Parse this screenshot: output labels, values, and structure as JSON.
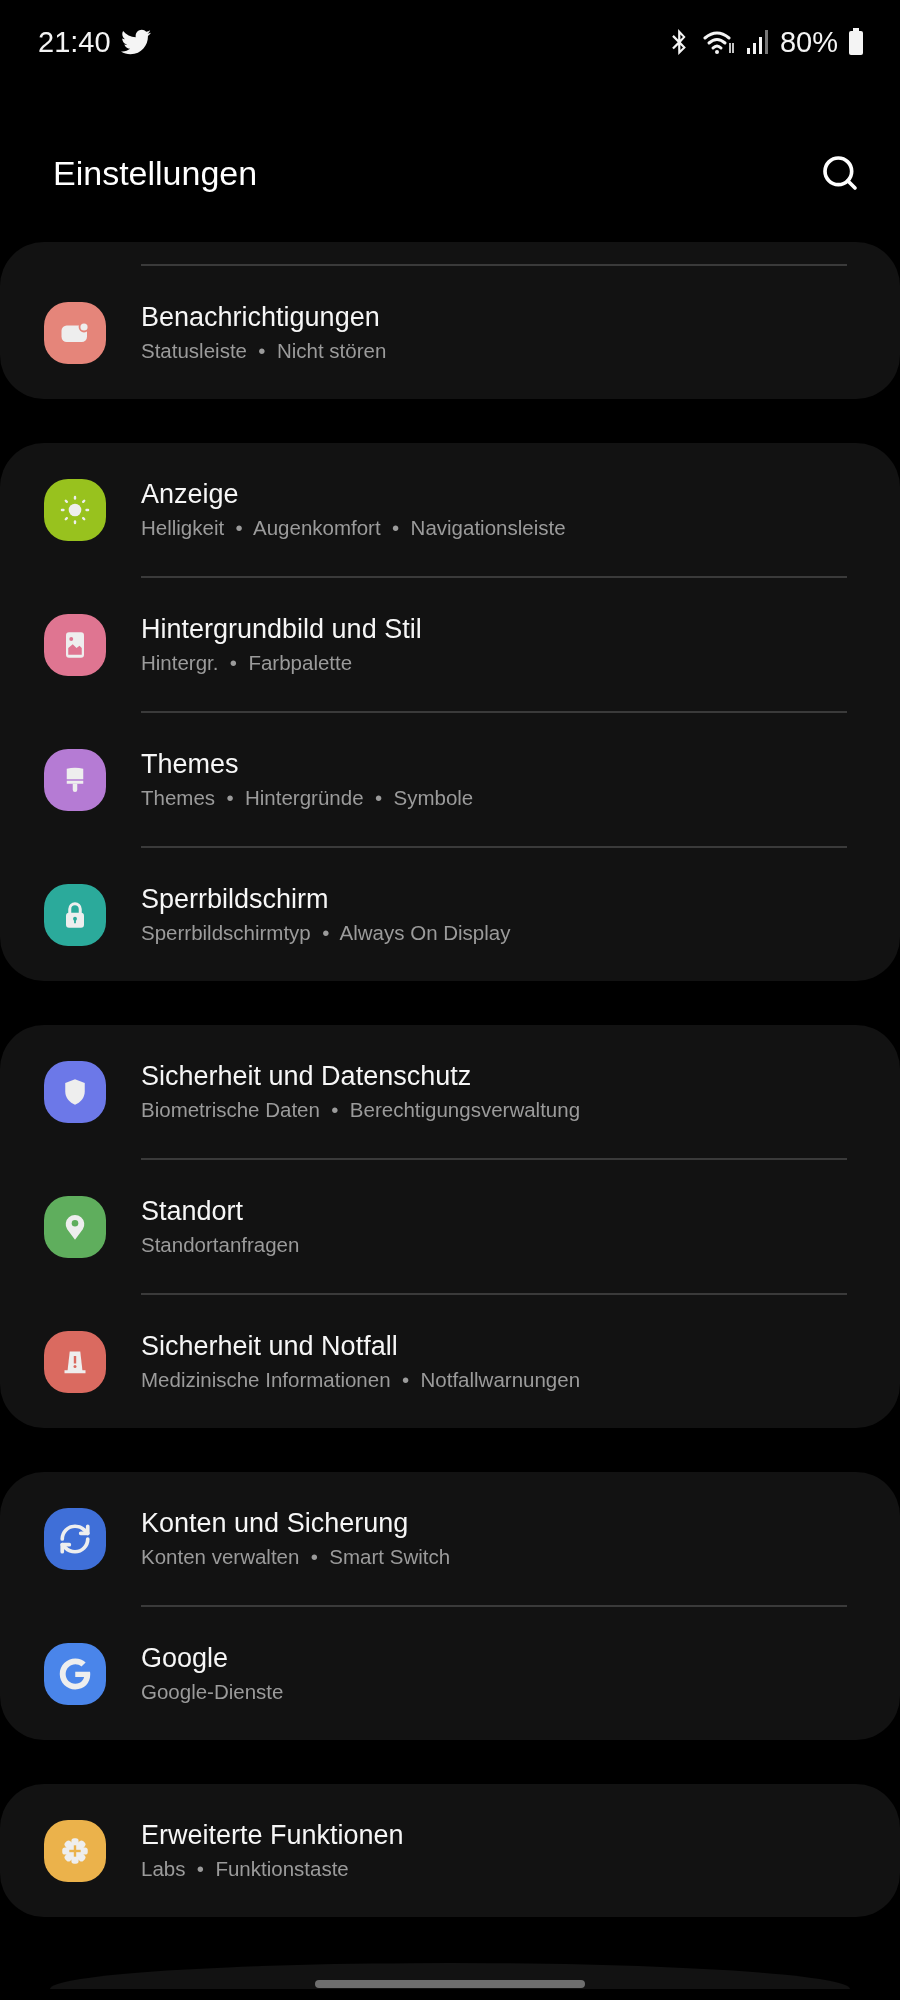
{
  "status_bar": {
    "time": "21:40",
    "battery": "80%"
  },
  "header": {
    "title": "Einstellungen"
  },
  "cards": [
    {
      "items": [
        {
          "kind": "notifications",
          "color": "#e5857a",
          "title": "Benachrichtigungen",
          "subtitle": "Statusleiste  •  Nicht stören"
        }
      ]
    },
    {
      "items": [
        {
          "kind": "display",
          "color": "#98c21e",
          "title": "Anzeige",
          "subtitle": "Helligkeit  •  Augenkomfort  •  Navigationsleiste"
        },
        {
          "kind": "wallpaper",
          "color": "#df7591",
          "title": "Hintergrundbild und Stil",
          "subtitle": "Hintergr.  •  Farbpalette"
        },
        {
          "kind": "themes",
          "color": "#b57bd4",
          "title": "Themes",
          "subtitle": "Themes  •  Hintergründe  •  Symbole"
        },
        {
          "kind": "lock",
          "color": "#2baa9b",
          "title": "Sperrbildschirm",
          "subtitle": "Sperrbildschirmtyp  •  Always On Display"
        }
      ]
    },
    {
      "items": [
        {
          "kind": "security",
          "color": "#6c78e8",
          "title": "Sicherheit und Datenschutz",
          "subtitle": "Biometrische Daten  •  Berechtigungsverwaltung"
        },
        {
          "kind": "location",
          "color": "#5fae5d",
          "title": "Standort",
          "subtitle": "Standortanfragen"
        },
        {
          "kind": "emergency",
          "color": "#da6a60",
          "title": "Sicherheit und Notfall",
          "subtitle": "Medizinische Informationen  •  Notfallwarnungen"
        }
      ]
    },
    {
      "items": [
        {
          "kind": "accounts",
          "color": "#3f6fd8",
          "title": "Konten und Sicherung",
          "subtitle": "Konten verwalten  •  Smart Switch"
        },
        {
          "kind": "google",
          "color": "#4a85ea",
          "title": "Google",
          "subtitle": "Google-Dienste"
        }
      ]
    },
    {
      "items": [
        {
          "kind": "advanced",
          "color": "#ebb24b",
          "title": "Erweiterte Funktionen",
          "subtitle": "Labs  •  Funktionstaste"
        }
      ]
    }
  ]
}
